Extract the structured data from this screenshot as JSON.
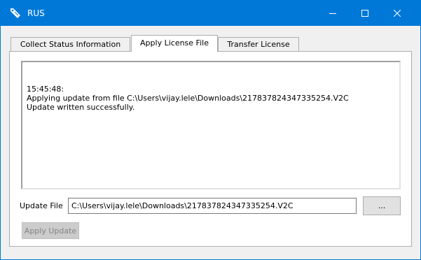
{
  "window": {
    "title": "RUS",
    "accent_color": "#0078d7",
    "icons": {
      "app": "key-tag-icon",
      "minimize": "minimize-icon",
      "maximize": "maximize-icon",
      "close": "close-icon"
    }
  },
  "tabs": [
    {
      "label": "Collect Status Information",
      "active": false
    },
    {
      "label": "Apply License File",
      "active": true
    },
    {
      "label": "Transfer License",
      "active": false
    }
  ],
  "log": {
    "lines": [
      "15:45:48:",
      "Applying update from file C:\\Users\\vijay.lele\\Downloads\\217837824347335254.V2C",
      "Update written successfully."
    ]
  },
  "update_file": {
    "label": "Update File",
    "value": "C:\\Users\\vijay.lele\\Downloads\\217837824347335254.V2C",
    "browse_label": "..."
  },
  "apply_button": {
    "label": "Apply Update",
    "enabled": false
  }
}
